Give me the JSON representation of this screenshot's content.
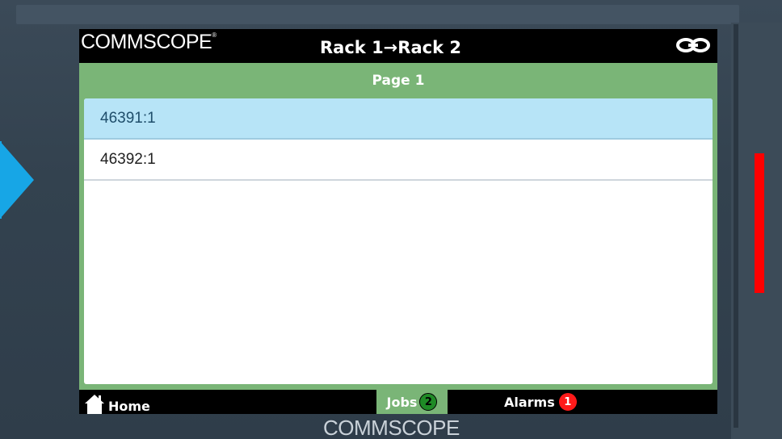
{
  "header": {
    "logo_text": "COMMSCOPE",
    "logo_mark": "®",
    "title": "Rack 1→Rack 2",
    "link_icon": "link-icon"
  },
  "page_bar": {
    "label": "Page 1"
  },
  "list": {
    "items": [
      {
        "label": "46391:1",
        "selected": true
      },
      {
        "label": "46392:1",
        "selected": false
      }
    ]
  },
  "footer": {
    "home_label": "Home",
    "jobs_label": "Jobs",
    "jobs_count": "2",
    "alarms_label": "Alarms",
    "alarms_count": "1"
  },
  "device": {
    "bottom_logo": "COMMSCOPE"
  },
  "colors": {
    "accent_green": "#7ab577",
    "selected_row": "#b7e4f7",
    "alarm_red": "#ff1a1a",
    "nav_arrow": "#17a6e6"
  }
}
